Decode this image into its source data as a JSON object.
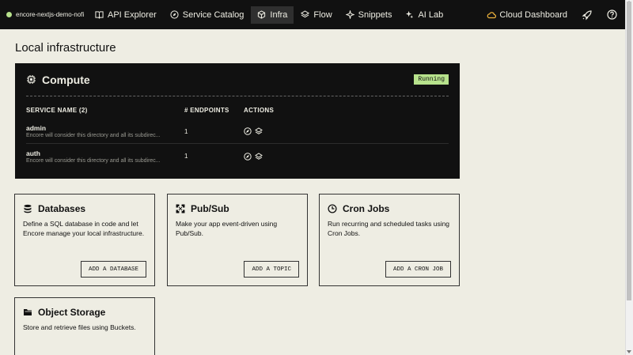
{
  "app": {
    "name": "encore-nextjs-demo-nofi",
    "status_color": "#b7e28c"
  },
  "nav": [
    {
      "label": "API Explorer",
      "icon": "book-icon",
      "active": false
    },
    {
      "label": "Service Catalog",
      "icon": "compass-icon",
      "active": false
    },
    {
      "label": "Infra",
      "icon": "cube-icon",
      "active": true
    },
    {
      "label": "Flow",
      "icon": "flow-icon",
      "active": false
    },
    {
      "label": "Snippets",
      "icon": "sparkle-icon",
      "active": false
    },
    {
      "label": "AI Lab",
      "icon": "ai-icon",
      "active": false
    }
  ],
  "header_right": {
    "cloud_label": "Cloud Dashboard",
    "cloud_icon": "cloud-icon",
    "deploy_icon": "rocket-icon",
    "help_icon": "help-icon"
  },
  "page": {
    "title": "Local infrastructure"
  },
  "compute": {
    "title": "Compute",
    "status": "Running",
    "columns": {
      "service_name": "SERVICE NAME (2)",
      "endpoints": "# ENDPOINTS",
      "actions": "ACTIONS"
    },
    "rows": [
      {
        "name": "admin",
        "description": "Encore will consider this directory and all its subdirec...",
        "endpoints": "1"
      },
      {
        "name": "auth",
        "description": "Encore will consider this directory and all its subdirec...",
        "endpoints": "1"
      }
    ]
  },
  "cards": [
    {
      "title": "Databases",
      "icon": "database-icon",
      "description": "Define a SQL database in code and let Encore manage your local infrastructure.",
      "button": "ADD A DATABASE"
    },
    {
      "title": "Pub/Sub",
      "icon": "pubsub-icon",
      "description": "Make your app event-driven using Pub/Sub.",
      "button": "ADD A TOPIC"
    },
    {
      "title": "Cron Jobs",
      "icon": "clock-icon",
      "description": "Run recurring and scheduled tasks using Cron Jobs.",
      "button": "ADD A CRON JOB"
    },
    {
      "title": "Object Storage",
      "icon": "folder-icon",
      "description": "Store and retrieve files using Buckets."
    }
  ]
}
